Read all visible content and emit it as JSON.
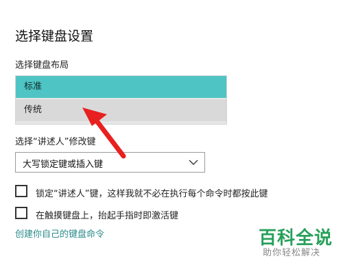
{
  "page": {
    "title": "选择键盘设置",
    "layout_label": "选择键盘布局",
    "layout_options": [
      "标准",
      "传统"
    ],
    "selected_layout": "标准",
    "modifier_label": "选择“讲述人”修改键",
    "modifier_select_value": "大写锁定键或插入键",
    "checkboxes": [
      {
        "label": "锁定“讲述人”键，这样我就不必在执行每个命令时都按此键",
        "checked": false
      },
      {
        "label": "在触摸键盘上，抬起手指时即激活键",
        "checked": false
      }
    ],
    "link_text": "创建你自己的键盘命令"
  },
  "watermark": {
    "main": "百科全说",
    "sub": "助你轻松解决"
  },
  "colors": {
    "selected_bg": "#4fc4c4",
    "link": "#2b8a8a",
    "arrow": "#e8201f",
    "brand": "#27a05a"
  }
}
